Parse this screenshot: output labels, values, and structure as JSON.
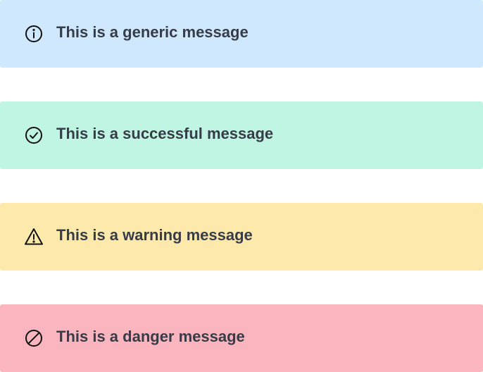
{
  "alerts": [
    {
      "type": "generic",
      "message": "This is a generic message",
      "icon": "info-icon",
      "background": "#cfe8fd"
    },
    {
      "type": "success",
      "message": "This is a successful message",
      "icon": "check-circle-icon",
      "background": "#c0f5e3"
    },
    {
      "type": "warning",
      "message": "This is a warning message",
      "icon": "warning-triangle-icon",
      "background": "#fee9ad"
    },
    {
      "type": "danger",
      "message": "This is a danger message",
      "icon": "prohibited-icon",
      "background": "#fab5be"
    }
  ],
  "colors": {
    "text": "#363c48",
    "icon": "#111111"
  }
}
